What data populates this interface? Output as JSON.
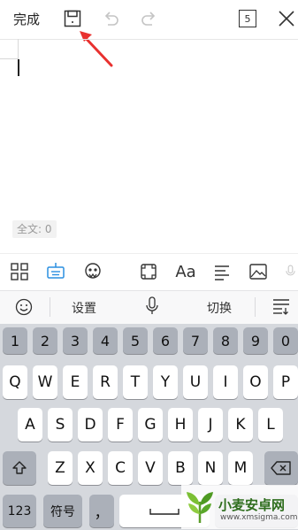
{
  "toolbar": {
    "done_label": "完成",
    "icons": [
      "save-icon",
      "undo-icon",
      "redo-icon",
      "page-count-icon",
      "close-icon"
    ],
    "page_count": "5"
  },
  "editor": {
    "word_count_label": "全文: 0"
  },
  "format_toolbar": {
    "icons": [
      "layout-icon",
      "keyboard-icon",
      "voice-face-icon",
      "crop-icon",
      "font-icon",
      "align-icon",
      "image-icon",
      "mic-icon"
    ],
    "font_label": "Aa"
  },
  "suggestion_bar": {
    "settings_label": "设置",
    "switch_label": "切换",
    "icons": [
      "emoji-icon",
      "mic-icon",
      "menu-icon"
    ]
  },
  "keyboard": {
    "number_row": [
      "1",
      "2",
      "3",
      "4",
      "5",
      "6",
      "7",
      "8",
      "9",
      "0"
    ],
    "row1": [
      "Q",
      "W",
      "E",
      "R",
      "T",
      "Y",
      "U",
      "I",
      "O",
      "P"
    ],
    "row2": [
      "A",
      "S",
      "D",
      "F",
      "G",
      "H",
      "J",
      "K",
      "L"
    ],
    "row3": [
      "Z",
      "X",
      "C",
      "V",
      "B",
      "N",
      "M"
    ],
    "bottom": {
      "num_label": "123",
      "symbol_label": "符号",
      "comma": "，"
    }
  },
  "colors": {
    "accent_blue": "#2a8fe0",
    "arrow_red": "#e8312f",
    "keyboard_bg": "#d5d8dd"
  },
  "watermark": {
    "title": "小麦安卓网",
    "url": "www.xmsigma.com"
  }
}
